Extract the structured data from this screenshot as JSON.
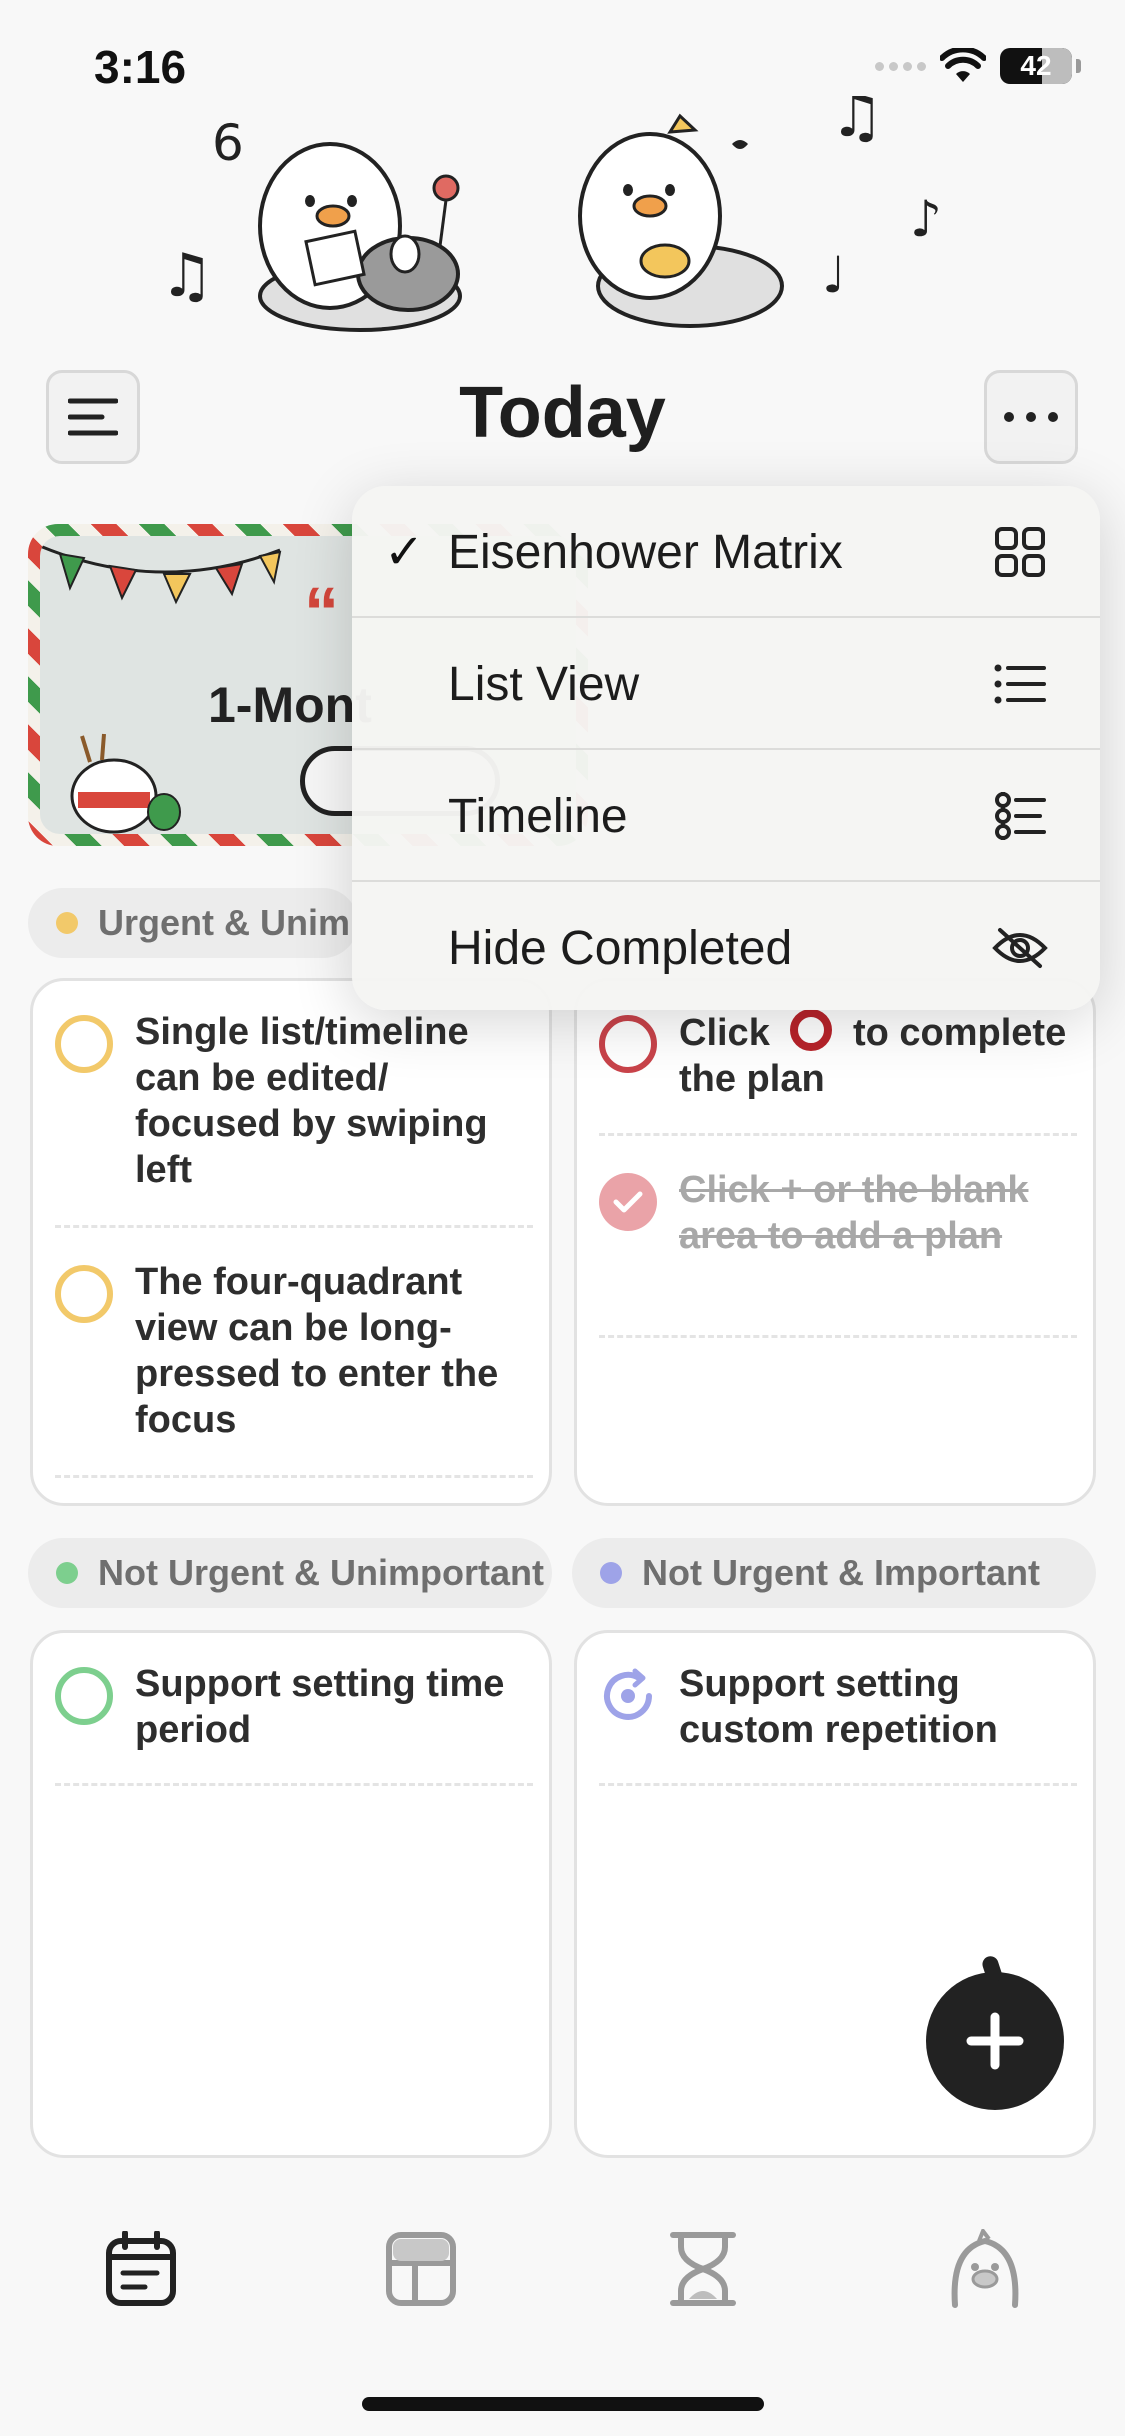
{
  "status": {
    "time": "3:16",
    "battery": "42"
  },
  "header": {
    "title": "Today"
  },
  "banner": {
    "quote_mark": "“",
    "title": "1-Mont"
  },
  "popup_menu": {
    "items": [
      {
        "label": "Eisenhower Matrix",
        "checked": true,
        "icon": "grid-icon"
      },
      {
        "label": "List View",
        "checked": false,
        "icon": "list-icon"
      },
      {
        "label": "Timeline",
        "checked": false,
        "icon": "timeline-icon"
      },
      {
        "label": "Hide Completed",
        "checked": false,
        "icon": "eye-slash-icon"
      }
    ],
    "check_mark": "✓"
  },
  "quadrants": {
    "urgent_unimportant": {
      "label": "Urgent & Unim",
      "color": "#f2c96a",
      "tasks": [
        "Single list/timeline can be edited/ focused by swiping left",
        "The four-quadrant view can be long-pressed to enter the focus"
      ]
    },
    "urgent_important": {
      "color": "#c9434a",
      "task_click_prefix": "Click",
      "task_click_suffix": "to complete the plan",
      "task_done": "Click + or the blank area to add a plan"
    },
    "not_urgent_unimportant": {
      "label": "Not Urgent & Unimportant",
      "color": "#7dcf8e",
      "tasks": [
        "Support setting time period"
      ]
    },
    "not_urgent_important": {
      "label": "Not Urgent & Important",
      "color": "#9ea3e8",
      "tasks": [
        "Support setting custom repetition"
      ]
    }
  },
  "tabbar": {
    "items": [
      "calendar-icon",
      "layout-icon",
      "hourglass-icon",
      "duck-icon"
    ]
  }
}
